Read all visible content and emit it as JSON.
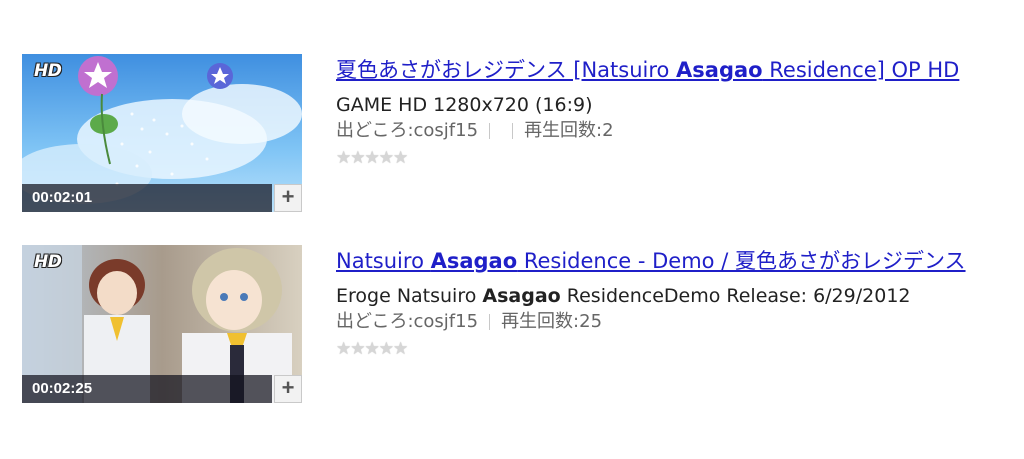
{
  "results": [
    {
      "hd_badge": "HD",
      "duration": "00:02:01",
      "add_label": "+",
      "title_pre": "夏色あさがおレジデンス [Natsuiro ",
      "title_bold": "Asagao",
      "title_post": " Residence] OP HD",
      "desc_pre": "GAME HD 1280x720 (16:9)",
      "desc_bold": "",
      "desc_post": "",
      "source": "出どころ:cosjf15",
      "views": "再生回数:2",
      "rating_icon": "star-empty"
    },
    {
      "hd_badge": "HD",
      "duration": "00:02:25",
      "add_label": "+",
      "title_pre": "Natsuiro ",
      "title_bold": "Asagao",
      "title_post": " Residence - Demo / 夏色あさがおレジデンス",
      "desc_pre": "Eroge Natsuiro ",
      "desc_bold": "Asagao",
      "desc_post": " ResidenceDemo Release: 6/29/2012",
      "source": "出どころ:cosjf15",
      "views": "再生回数:25",
      "rating_icon": "star-empty"
    }
  ],
  "colors": {
    "link": "#1f1fc8",
    "meta": "#666666",
    "text": "#222222"
  }
}
